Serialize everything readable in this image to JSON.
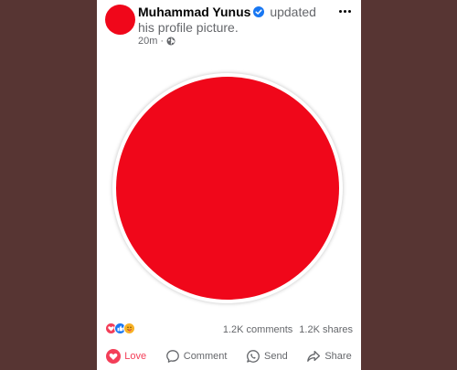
{
  "post": {
    "author": "Muhammad Yunus",
    "action_text": "updated his profile picture.",
    "time": "20m",
    "avatar_color": "#f0071a",
    "photo_color": "#f0071a"
  },
  "icons": {
    "verified": "verified-badge-icon",
    "audience": "globe-icon",
    "menu": "more-options-icon"
  },
  "stats": {
    "comments": "1.2K comments",
    "shares": "1.2K shares",
    "reaction_icons": [
      "love-reaction-icon",
      "like-reaction-icon",
      "care-reaction-icon"
    ]
  },
  "actions": {
    "love": "Love",
    "comment": "Comment",
    "send": "Send",
    "share": "Share"
  },
  "colors": {
    "background": "#573533",
    "card": "#ffffff",
    "love_active": "#f33e58",
    "verified": "#1877f2",
    "muted_text": "#65676b"
  }
}
